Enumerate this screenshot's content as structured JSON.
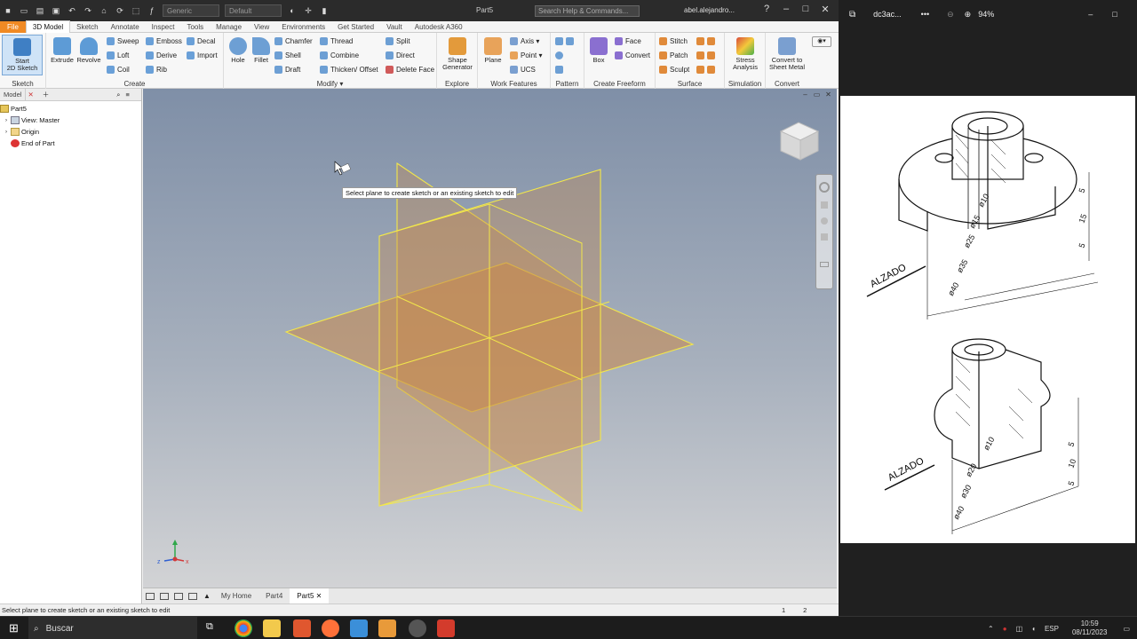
{
  "window": {
    "doc_title": "Part5",
    "search_placeholder": "Search Help & Commands...",
    "user": "abel.alejandro...",
    "style_combo": "Generic",
    "appearance_combo": "Default"
  },
  "menu_tabs": [
    "File",
    "3D Model",
    "Sketch",
    "Annotate",
    "Inspect",
    "Tools",
    "Manage",
    "View",
    "Environments",
    "Get Started",
    "Vault",
    "Autodesk A360"
  ],
  "active_tab": "3D Model",
  "ribbon": {
    "sketch": {
      "title": "Sketch",
      "start": "Start",
      "start2": "2D Sketch"
    },
    "create": {
      "title": "Create",
      "extrude": "Extrude",
      "revolve": "Revolve",
      "sweep": "Sweep",
      "loft": "Loft",
      "coil": "Coil",
      "emboss": "Emboss",
      "derive": "Derive",
      "rib": "Rib",
      "decal": "Decal",
      "import": "Import"
    },
    "modify": {
      "title": "Modify ▾",
      "hole": "Hole",
      "fillet": "Fillet",
      "chamfer": "Chamfer",
      "shell": "Shell",
      "draft": "Draft",
      "thread": "Thread",
      "combine": "Combine",
      "thicken": "Thicken/ Offset",
      "split": "Split",
      "direct": "Direct",
      "delete_face": "Delete Face"
    },
    "explore": {
      "title": "Explore",
      "shape": "Shape",
      "generator": "Generator"
    },
    "work": {
      "title": "Work Features",
      "plane": "Plane",
      "axis": "Axis ▾",
      "point": "Point ▾",
      "ucs": "UCS"
    },
    "pattern": {
      "title": "Pattern"
    },
    "freeform": {
      "title": "Create Freeform",
      "box": "Box",
      "face": "Face",
      "convert": "Convert"
    },
    "surface": {
      "title": "Surface",
      "stitch": "Stitch",
      "patch": "Patch",
      "sculpt": "Sculpt"
    },
    "simulation": {
      "title": "Simulation",
      "stress": "Stress",
      "analysis": "Analysis"
    },
    "convert": {
      "title": "Convert",
      "convert_to": "Convert to",
      "sheet_metal": "Sheet Metal"
    }
  },
  "browser": {
    "tab": "Model",
    "items": [
      "Part5",
      "View: Master",
      "Origin",
      "End of Part"
    ]
  },
  "viewport": {
    "tooltip": "Select plane to create sketch or an existing sketch to edit"
  },
  "doc_tabs": [
    "My Home",
    "Part4",
    "Part5"
  ],
  "active_doc": "Part5",
  "status": {
    "text": "Select plane to create sketch or an existing sketch to edit",
    "num1": "1",
    "num2": "2"
  },
  "viewer": {
    "filename": "dc3ac...",
    "zoom": "94%"
  },
  "taskbar": {
    "search": "Buscar",
    "lang": "ESP",
    "time": "10:59",
    "date": "08/11/2023"
  },
  "drawing": {
    "label_top": "ALZADO",
    "label_bottom": "ALZADO",
    "top_dims": [
      "ø10",
      "ø15",
      "ø25",
      "ø35",
      "ø40",
      "5",
      "15",
      "5"
    ],
    "bottom_dims": [
      "ø10",
      "ø20",
      "ø30",
      "ø40",
      "5",
      "10",
      "5"
    ]
  },
  "colors": {
    "file_tab": "#f08a24",
    "plane_fill": "#c8894a",
    "plane_edge": "#f2e74a"
  }
}
